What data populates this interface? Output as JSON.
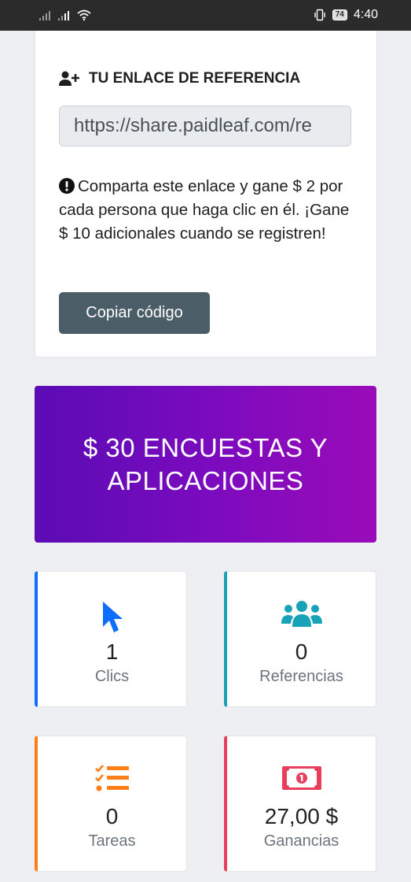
{
  "status_bar": {
    "time": "4:40",
    "battery": "74"
  },
  "referral": {
    "title": "TU ENLACE DE REFERENCIA",
    "link_value": "https://share.paidleaf.com/re",
    "note": "Comparta este enlace y gane $ 2 por cada persona que haga clic en él. ¡Gane $ 10 adicionales cuando se registren!",
    "copy_label": "Copiar código"
  },
  "promo": {
    "line1": "$ 30 ENCUESTAS Y",
    "line2": "APLICACIONES"
  },
  "stats": [
    {
      "value": "1",
      "label": "Clics",
      "accent": "#0d6efd",
      "icon": "cursor-icon"
    },
    {
      "value": "0",
      "label": "Referencias",
      "accent": "#17a2b8",
      "icon": "users-icon"
    },
    {
      "value": "0",
      "label": "Tareas",
      "accent": "#fd7e14",
      "icon": "tasks-icon"
    },
    {
      "value": "27,00 $",
      "label": "Ganancias",
      "accent": "#e83e5c",
      "icon": "money-icon"
    }
  ],
  "colors": {
    "background": "#eeeff2",
    "button": "#4b5d66",
    "promo_start": "#5b0bb5",
    "promo_end": "#9a0bb8"
  }
}
